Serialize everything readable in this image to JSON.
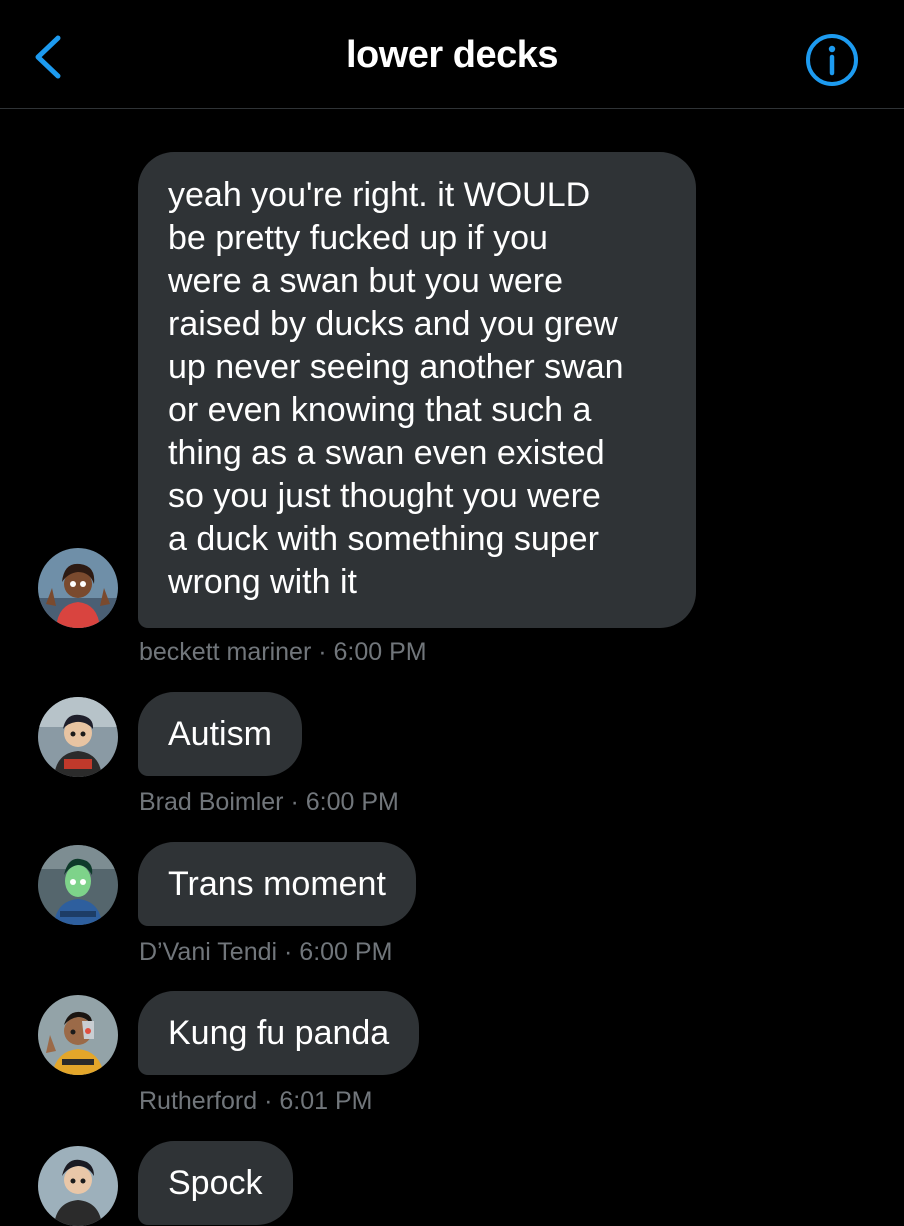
{
  "header": {
    "title": "lower decks",
    "back_icon": "chevron-left-icon",
    "info_icon": "info-circle-icon",
    "accent_color": "#1d9bf0"
  },
  "colors": {
    "background": "#000000",
    "bubble": "#2f3336",
    "meta_text": "#71767b"
  },
  "messages": [
    {
      "sender": "beckett mariner",
      "time": "6:00 PM",
      "lines": [
        "yeah you're right. it WOULD",
        "be pretty fucked up if you",
        "were a swan but you were",
        "raised by ducks and you grew",
        "up never seeing another swan",
        "or even knowing that such a",
        "thing as a swan even existed",
        "so you just thought you were",
        "a duck with something super",
        "wrong with it"
      ]
    },
    {
      "sender": "Brad Boimler",
      "time": "6:00 PM",
      "text": "Autism"
    },
    {
      "sender": "D’Vani Tendi",
      "time": "6:00 PM",
      "text": "Trans moment"
    },
    {
      "sender": "Rutherford",
      "time": "6:01 PM",
      "text": "Kung fu panda"
    },
    {
      "text": "Spock"
    }
  ]
}
